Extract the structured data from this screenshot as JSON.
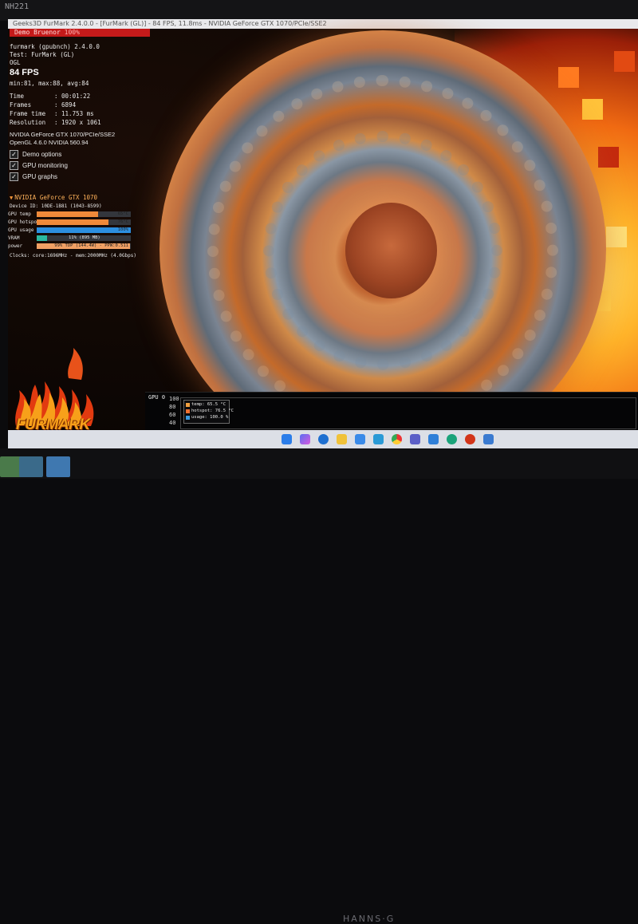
{
  "bezel": {
    "label": "NH221",
    "brand": "HANNS·G"
  },
  "window": {
    "title": "Geeks3D FurMark 2.4.0.0 - [FurMark (GL)] - 84 FPS, 11.8ms - NVIDIA GeForce GTX 1070/PCIe/SSE2"
  },
  "hud": {
    "demo_label": "Demo Bruenor",
    "demo_value": "100%",
    "app_line": "furmark (gpubnch) 2.4.0.0",
    "test_line": "Test: FurMark (GL)",
    "api_line": "OGL",
    "fps": "84 FPS",
    "minmax": "min:81, max:88, avg:84",
    "stats": [
      {
        "key": "Time",
        "value": ": 00:01:22"
      },
      {
        "key": "Frames",
        "value": ": 6894"
      },
      {
        "key": "Frame time",
        "value": ": 11.753 ms"
      },
      {
        "key": "Resolution",
        "value": ": 1920 x 1061"
      }
    ],
    "renderer": "NVIDIA GeForce GTX 1070/PCIe/SSE2",
    "opengl": "OpenGL 4.6.0 NVIDIA 560.94",
    "options": [
      {
        "label": "Demo options",
        "checked": true
      },
      {
        "label": "GPU monitoring",
        "checked": true
      },
      {
        "label": "GPU graphs",
        "checked": true
      }
    ],
    "gpu_name": "NVIDIA GeForce GTX 1070",
    "device_id": "Device ID:  10DE-1B81 (1043-8599)",
    "bars": [
      {
        "label": "GPU temp",
        "value": "65°C",
        "fill": 0.65,
        "color": "#f08a3a"
      },
      {
        "label": "GPU hotspot",
        "value": "76°C",
        "fill": 0.76,
        "color": "#f08a3a"
      },
      {
        "label": "GPU usage",
        "value": "100%",
        "fill": 1.0,
        "color": "#2c8fe0"
      },
      {
        "label": "VRAM",
        "value": "11% (895 MB)",
        "fill": 0.11,
        "color": "#2ab8a0"
      },
      {
        "label": "power",
        "value": "99% TDP (144.4W) - PPW:0.511",
        "fill": 0.99,
        "color": "#f0a064"
      }
    ],
    "clocks": "Clocks:   core:1696MHz - mem:2000MHz (4.0Gbps)"
  },
  "logo": {
    "text": "FURMARK"
  },
  "graph": {
    "title": "GPU 0",
    "y_ticks": [
      "100",
      "80",
      "60",
      "40"
    ],
    "legend": [
      {
        "text": "temp: 65.5 °C",
        "color": "#f0a040"
      },
      {
        "text": "hotspot: 76.5 °C",
        "color": "#f07030"
      },
      {
        "text": "usage: 100.0 %",
        "color": "#3a9ae0"
      }
    ]
  },
  "taskbar": {
    "icons": [
      "windows-start-icon",
      "copilot-icon",
      "edge-icon",
      "file-explorer-icon",
      "store-icon",
      "photos-icon",
      "chrome-icon",
      "teams-icon",
      "app-icon",
      "app-icon-2",
      "furmark-icon",
      "app-icon-3"
    ]
  }
}
